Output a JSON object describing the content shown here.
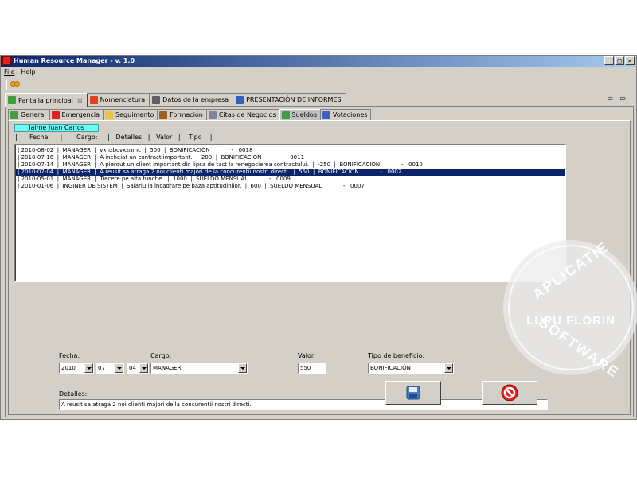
{
  "window": {
    "title": "Human Resource Manager  -  v. 1.0",
    "minimize": "_",
    "maximize": "□",
    "close": "×"
  },
  "menu": [
    "File",
    "Help"
  ],
  "main_tabs": [
    {
      "label": "Pantalla principal",
      "closable": "⊠",
      "icon": "home-icon",
      "color": "#40a040"
    },
    {
      "label": "Nomenclatura",
      "icon": "list-icon",
      "color": "#e04020"
    },
    {
      "label": "Datos de la empresa",
      "icon": "building-icon",
      "color": "#606060"
    },
    {
      "label": "PRESENTACIÓN DE INFORMES",
      "icon": "report-icon",
      "color": "#3060c0"
    }
  ],
  "view_controls": "▭ ▭",
  "sub_tabs": [
    {
      "label": "General",
      "icon": "general-icon",
      "color": "#40a040"
    },
    {
      "label": "Emergencia",
      "icon": "emergency-icon",
      "color": "#e02020"
    },
    {
      "label": "Seguimento",
      "icon": "folder-icon",
      "color": "#f0c040"
    },
    {
      "label": "Formación",
      "icon": "pencil-icon",
      "color": "#a06020"
    },
    {
      "label": "Citas de Negocios",
      "icon": "meeting-icon",
      "color": "#8080a0"
    },
    {
      "label": "Sueldos",
      "icon": "money-icon",
      "color": "#40a040"
    },
    {
      "label": "Votaciones",
      "icon": "vote-icon",
      "color": "#4060c0"
    }
  ],
  "employee_name": "Jaime Juan Carlos",
  "column_headers": "|      Fecha      |       Cargo:     |   Detalles   |   Valor   |    Tipo    |",
  "records": [
    "| 2010-08-02  |  MANAGER  |  vxnzbcvxznmc  |  500  |  BONIFICACIÓN            -   0018",
    "| 2010-07-16  |  MANAGER  |  A incheiat un contract important.  |  200  |  BONIFICACIÓN            -   0011",
    "| 2010-07-14  |  MANAGER  |  A pierdut un client important din lipsa de tact la renegocierea contractului.  |  -250  |  BONIFICACIÓN            -   0010",
    "| 2010-07-04  |  MANAGER  |  A reusit sa atraga 2 noi clienti majori de la concurentii nostri directi.  |  550  |  BONIFICACIÓN            -   0002",
    "| 2010-05-01  |  MANAGER  |  Trecere pe alta functie.  |  1000  |  SUELDO MENSUAL            -   0009",
    "| 2010-01-06  |  INGINER DE SISTEM  |  Salariu la incadrare pe baza aptitudinilor.  |  600  |  SUELDO MENSUAL            -   0007"
  ],
  "selected_record": 3,
  "form": {
    "fecha_label": "Fecha:",
    "year": "2010",
    "month": "07",
    "day": "04",
    "cargo_label": "Cargo:",
    "cargo": "MANAGER",
    "valor_label": "Valor:",
    "valor": "550",
    "tipo_label": "Tipo de beneficio:",
    "tipo": "BONIFICACIÓN",
    "detalles_label": "Detalles:",
    "detalles": "A reusit sa atraga 2 noi clienti majori de la concurentii nostri directi."
  },
  "buttons": {
    "save": "save-icon",
    "cancel": "cancel-icon"
  },
  "watermark": {
    "top": "APLICATIE",
    "center": "LUPU FLORIN",
    "bottom": "SOFTWARE"
  }
}
